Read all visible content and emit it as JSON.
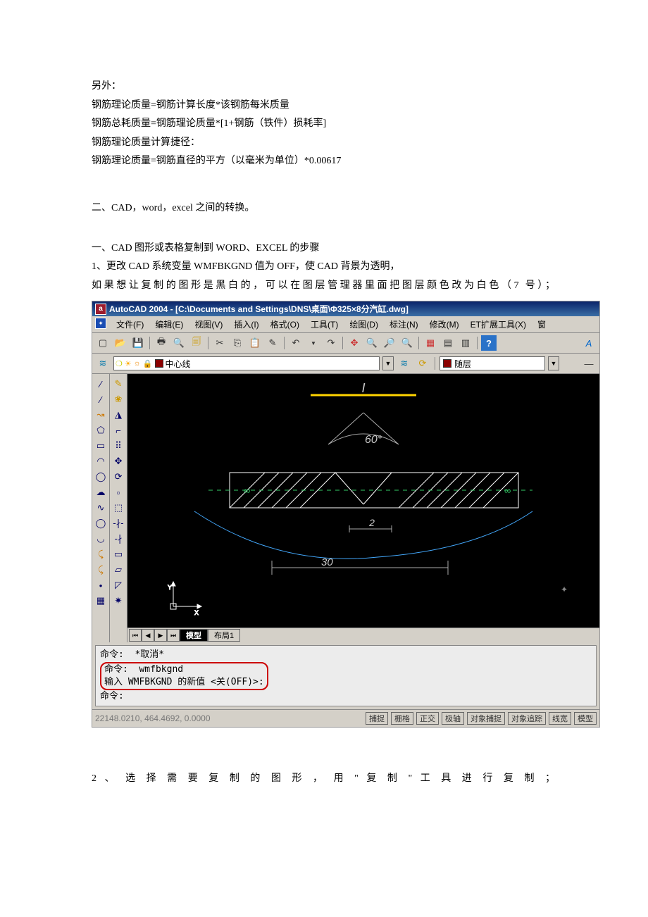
{
  "doc": {
    "intro_label": "另外：",
    "line1": "钢筋理论质量=钢筋计算长度*该钢筋每米质量",
    "line2": "钢筋总耗质量=钢筋理论质量*[1+钢筋（铁件）损耗率]",
    "line3": "钢筋理论质量计算捷径：",
    "line4": "钢筋理论质量=钢筋直径的平方（以毫米为单位）*0.00617",
    "section2": "二、CAD，word，excel 之间的转换。",
    "step1_title": "一、CAD 图形或表格复制到 WORD、EXCEL 的步骤",
    "step1_1": "1、更改 CAD 系统变量 WMFBKGND 值为 OFF，使 CAD 背景为透明，",
    "step1_2": "如果想让复制的图形是黑白的，可以在图层管理器里面把图层颜色改为白色（7 号）；",
    "step2": "2 、 选 择 需 要 复 制 的 图 形 ， 用 \" 复 制 \" 工 具 进 行 复 制 ；"
  },
  "shot": {
    "title": "AutoCAD 2004 - [C:\\Documents and Settings\\DNS\\桌面\\Φ325×8分汽缸.dwg]",
    "appicon_text": "a",
    "menu": {
      "file": "文件(F)",
      "edit": "编辑(E)",
      "view": "视图(V)",
      "insert": "插入(I)",
      "format": "格式(O)",
      "tools": "工具(T)",
      "draw": "绘图(D)",
      "dim": "标注(N)",
      "modify": "修改(M)",
      "et": "ET扩展工具(X)",
      "win": "窗"
    },
    "layer": {
      "name": "中心线",
      "bylayer": "随层"
    },
    "tabs": {
      "model": "模型",
      "layout1": "布局1"
    },
    "canvas": {
      "angle": "60°",
      "inf1": "∞",
      "inf2": "∞",
      "dim2": "2",
      "dim30": "30"
    },
    "cmd": {
      "l1": "命令:  *取消*",
      "l2a": "命令:  wmfbkgnd",
      "l2b": "输入 WMFBKGND 的新值 <关(OFF)>:",
      "l3": "命令:"
    },
    "status": {
      "coords": "22148.0210, 464.4692, 0.0000",
      "snap": "捕捉",
      "grid": "栅格",
      "ortho": "正交",
      "polar": "极轴",
      "osnap": "对象捕捉",
      "otrack": "对象追踪",
      "lwt": "线宽",
      "model": "模型"
    }
  }
}
